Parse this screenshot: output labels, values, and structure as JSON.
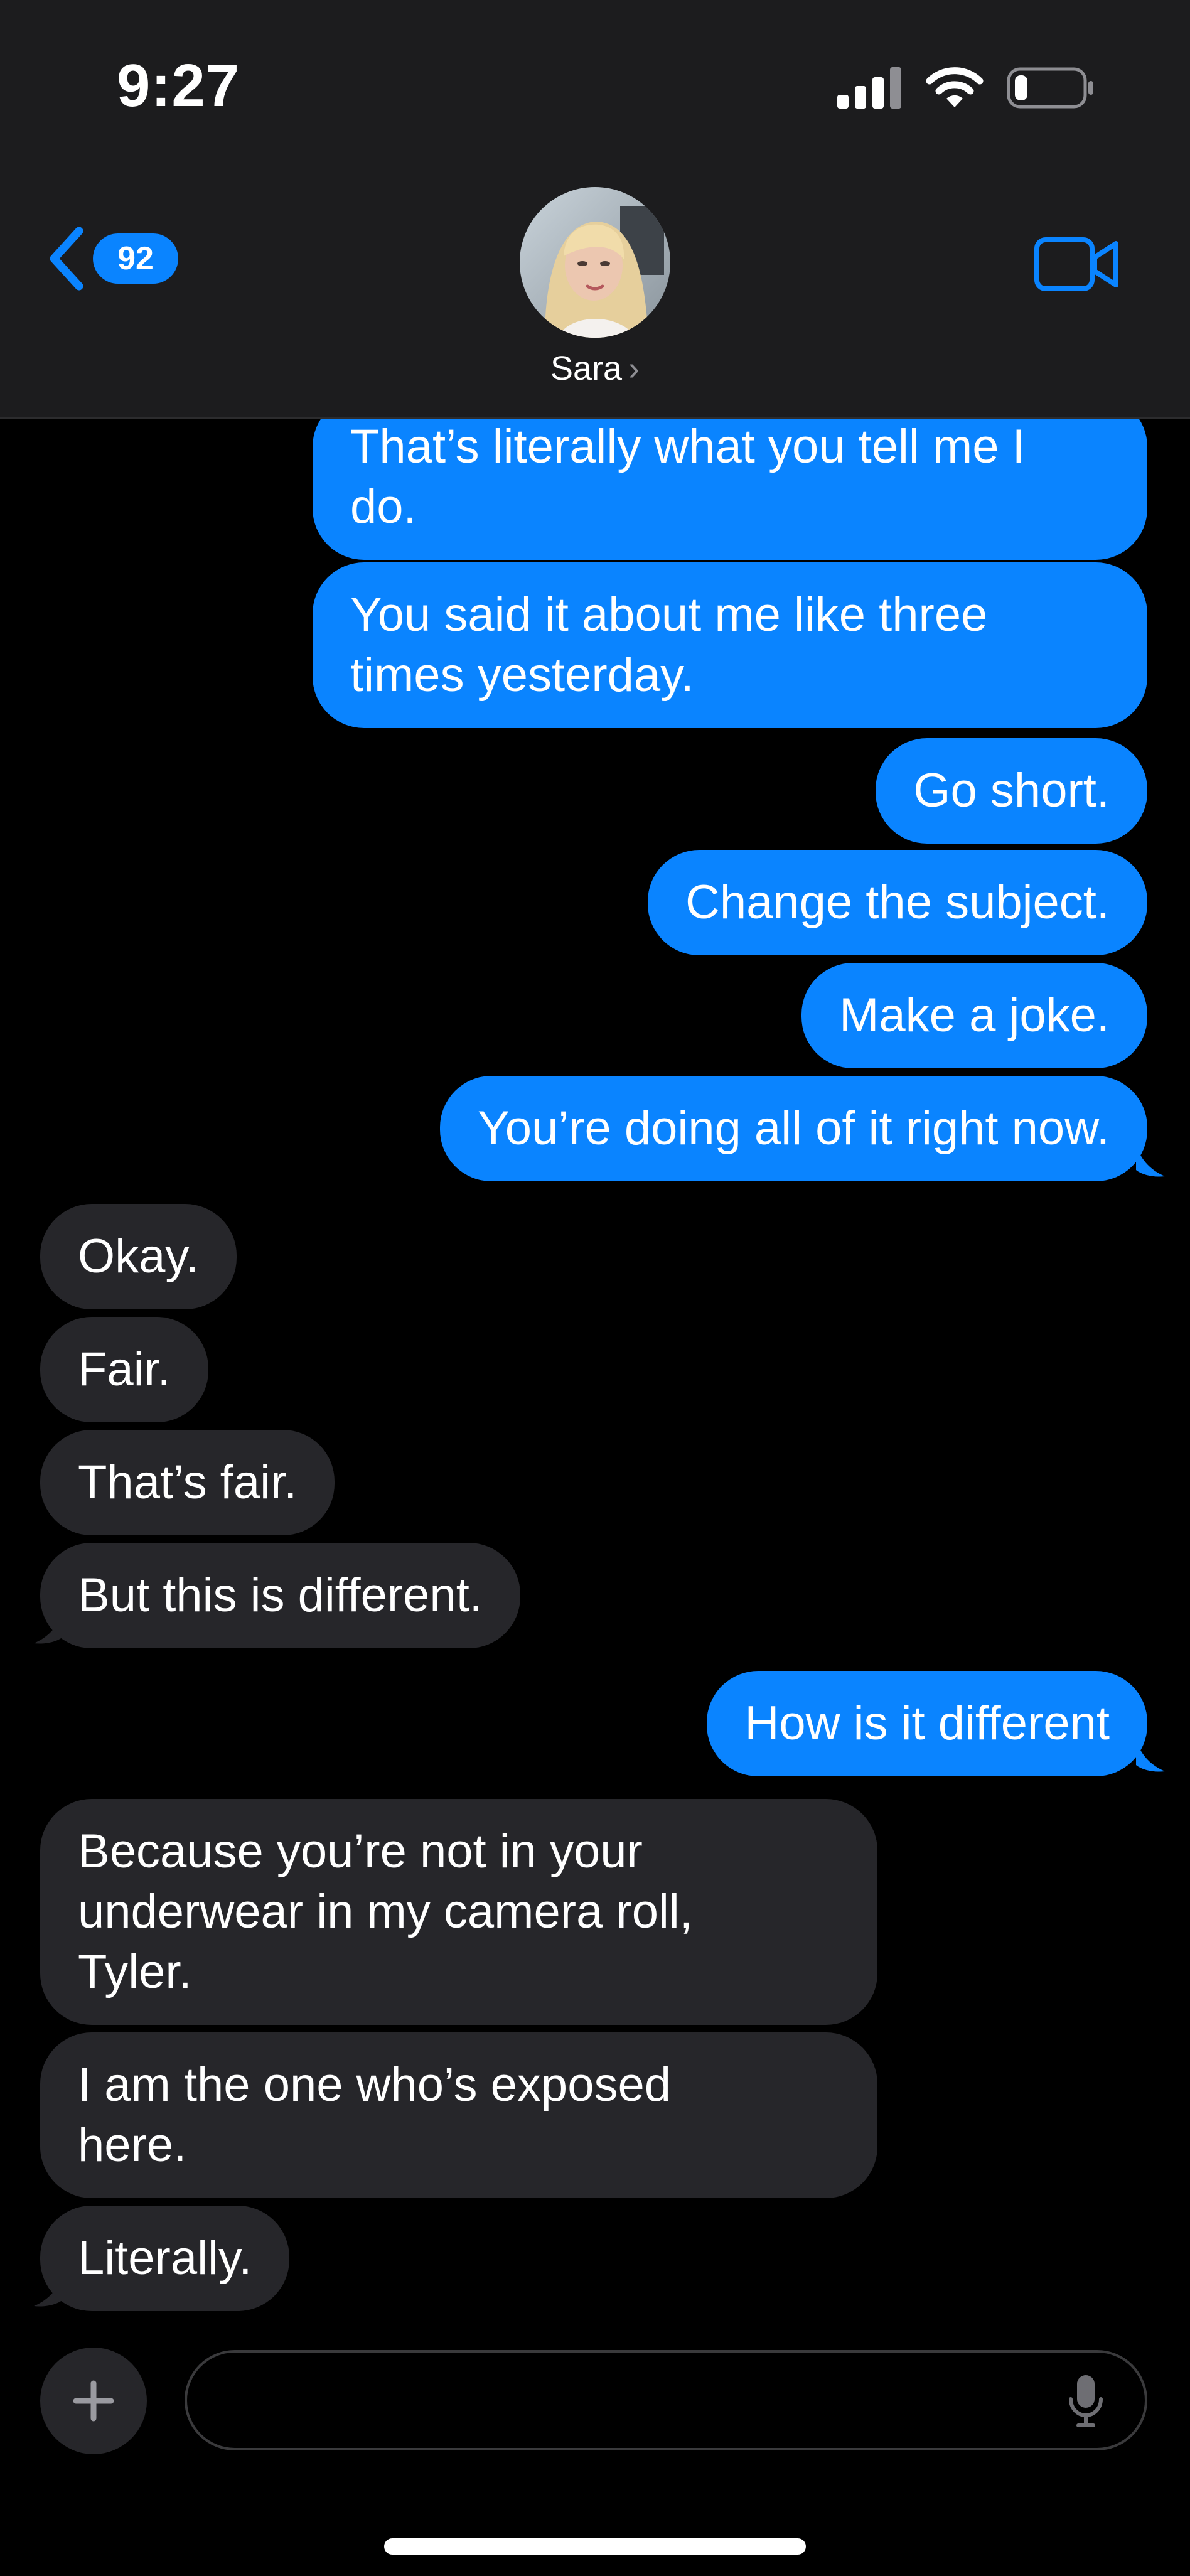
{
  "status_bar": {
    "time": "9:27",
    "battery_level": 0.2
  },
  "header": {
    "back_badge_count": "92",
    "contact_name": "Sara",
    "contact_chevron": "›",
    "icons": [
      "chevron-left-icon",
      "video-camera-icon",
      "signal-icon",
      "wifi-icon",
      "battery-icon"
    ]
  },
  "colors": {
    "header_background": "#1c1c1e",
    "sent_bubble": "#0a84ff",
    "received_bubble": "#26262a",
    "accent": "#0a84ff",
    "background": "#000000"
  },
  "messages": [
    {
      "from": "me",
      "text": "That’s literally what you tell me I\ndo."
    },
    {
      "from": "me",
      "text": "You said it about me like three\ntimes yesterday."
    },
    {
      "from": "me",
      "text": "Go short."
    },
    {
      "from": "me",
      "text": "Change the subject."
    },
    {
      "from": "me",
      "text": "Make a joke."
    },
    {
      "from": "me",
      "text": "You’re doing all of it right now."
    },
    {
      "from": "them",
      "text": "Okay."
    },
    {
      "from": "them",
      "text": "Fair."
    },
    {
      "from": "them",
      "text": "That’s fair."
    },
    {
      "from": "them",
      "text": "But this is different."
    },
    {
      "from": "me",
      "text": "How is it different"
    },
    {
      "from": "them",
      "text": "Because you’re not in your\nunderwear in my camera roll,\nTyler."
    },
    {
      "from": "them",
      "text": "I am the one who’s exposed\nhere."
    },
    {
      "from": "them",
      "text": "Literally."
    }
  ],
  "input_bar": {
    "value": "",
    "placeholder": "",
    "icons": [
      "plus-icon",
      "microphone-icon"
    ]
  }
}
